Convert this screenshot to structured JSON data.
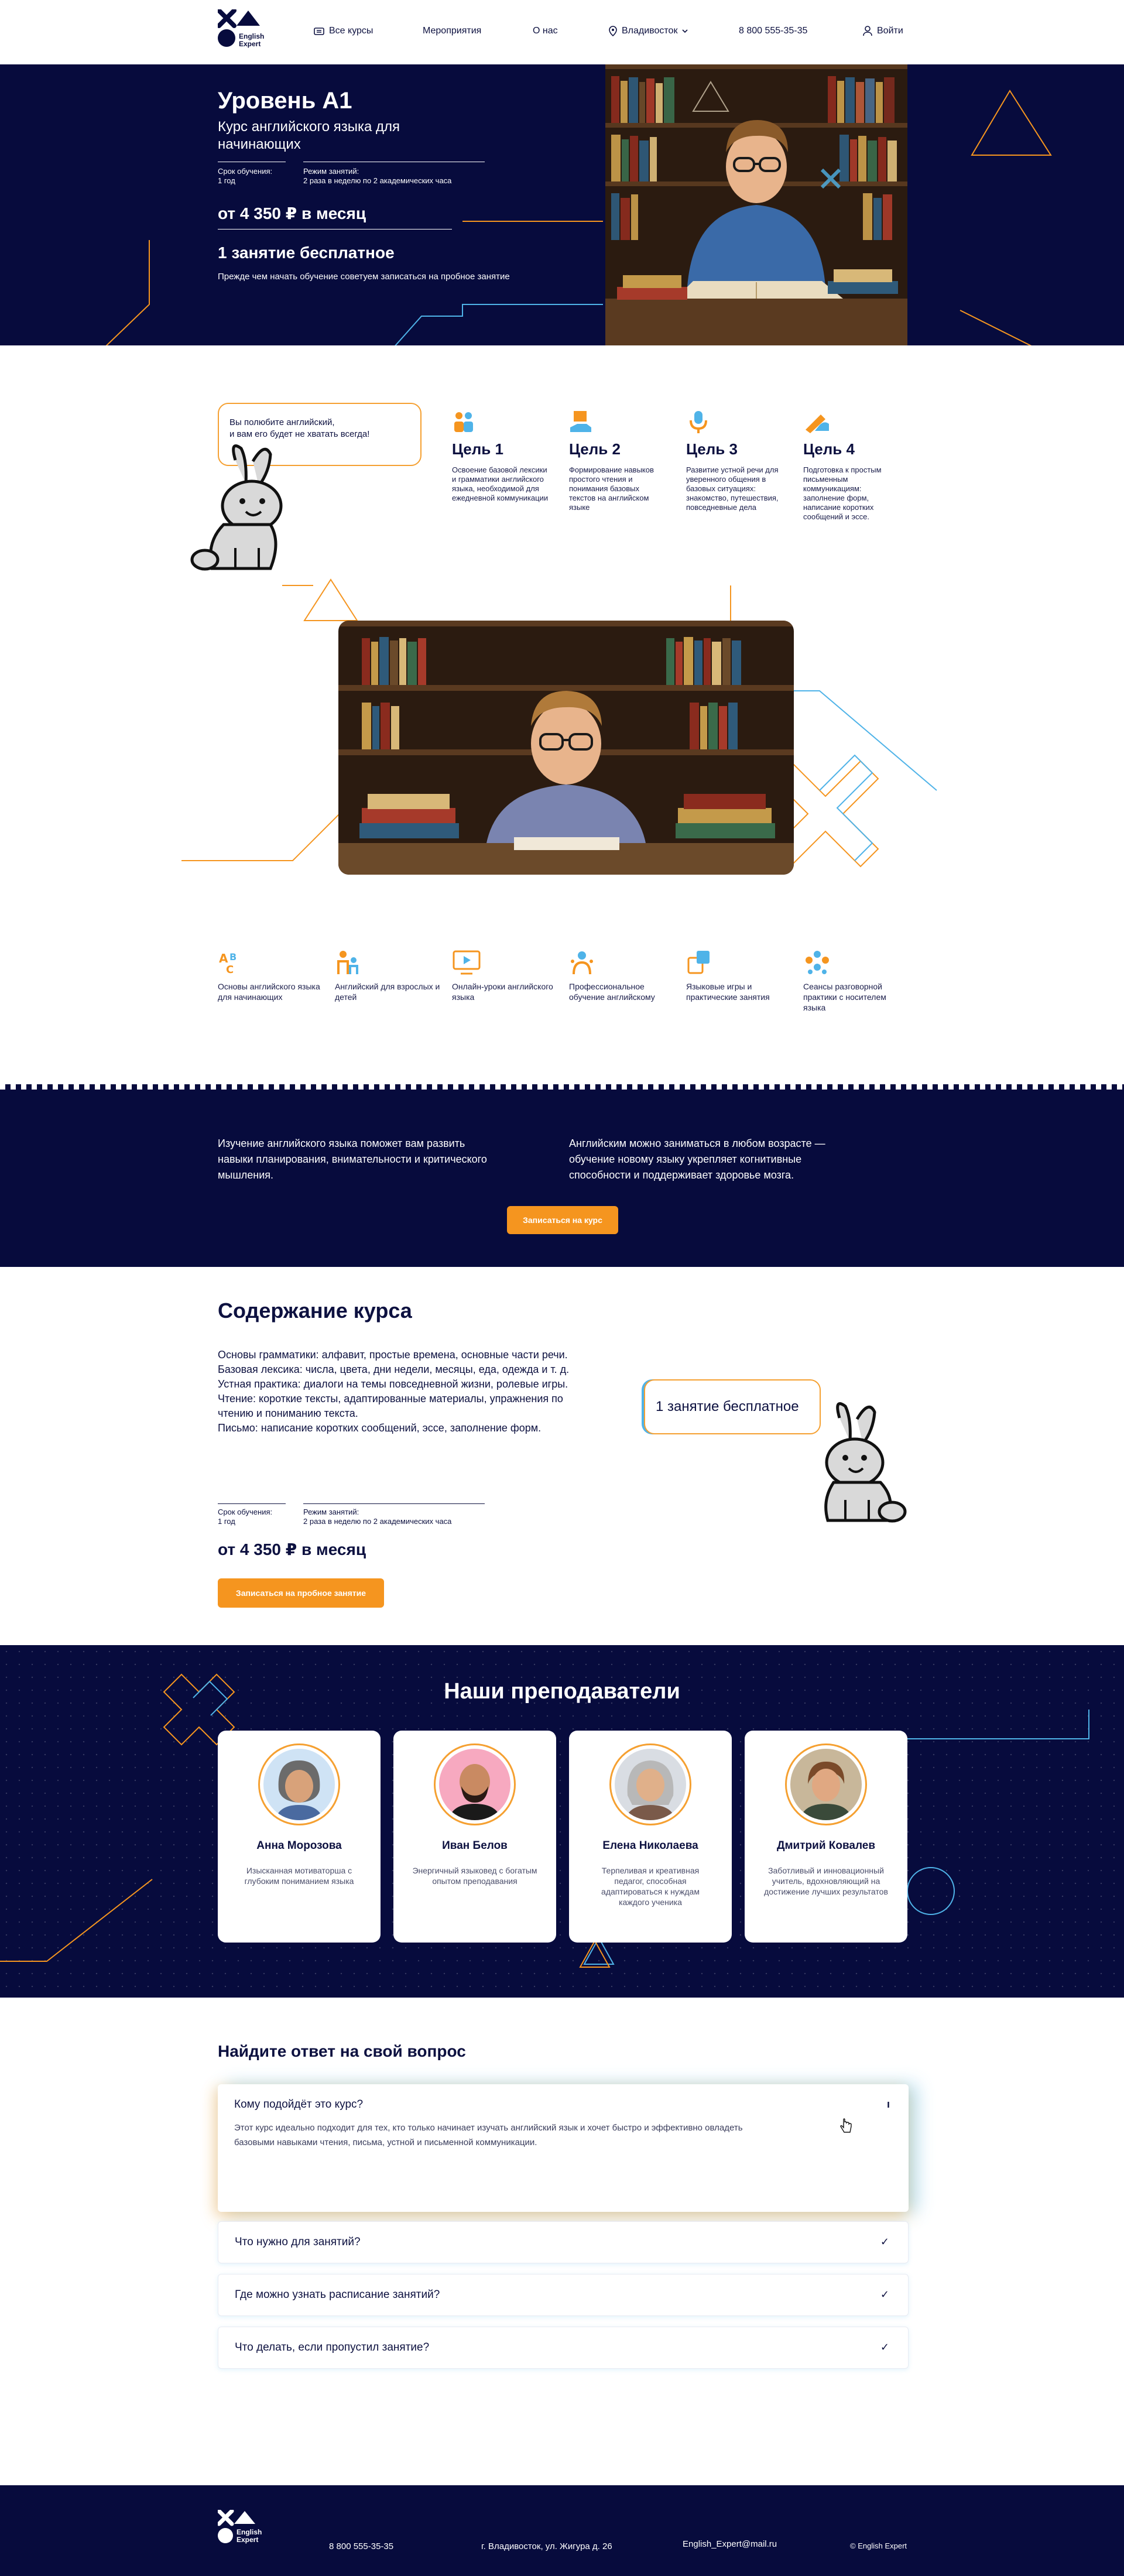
{
  "brand": {
    "name_line1": "English",
    "name_line2": "Expert"
  },
  "nav": {
    "courses": "Все курсы",
    "events": "Мероприятия",
    "about": "О нас",
    "city": "Владивосток",
    "phone": "8 800 555-35-35",
    "login": "Войти"
  },
  "hero": {
    "title": "Уровень А1",
    "subtitle": "Курс английского языка для начинающих",
    "duration_label": "Срок обучения:",
    "duration_value": "1 год",
    "schedule_label": "Режим занятий:",
    "schedule_value": "2 раза в неделю по 2 академических часа",
    "price": "от  4 350 ₽ в месяц",
    "free_lesson": "1 занятие бесплатное",
    "advice": "Прежде чем начать обучение советуем записаться на пробное занятие"
  },
  "bubble_goals": {
    "line1": "Вы полюбите английский,",
    "line2": "и вам его будет не хватать всегда!"
  },
  "goals": [
    {
      "title": "Цель 1",
      "text": "Освоение базовой лексики и грамматики английского языка, необходимой для ежедневной коммуникации"
    },
    {
      "title": "Цель 2",
      "text": "Формирование навыков простого чтения и понимания базовых текстов на английском языке"
    },
    {
      "title": "Цель 3",
      "text": "Развитие устной речи для уверенного общения в базовых ситуациях: знакомство, путешествия, повседневные дела"
    },
    {
      "title": "Цель 4",
      "text": "Подготовка к простым письменным коммуникациям: заполнение форм, написание коротких сообщений и эссе."
    }
  ],
  "features": [
    {
      "text": "Основы английского языка для начинающих"
    },
    {
      "text": "Английский для взрослых и детей"
    },
    {
      "text": "Онлайн-уроки английского языка"
    },
    {
      "text": "Профессиональное обучение английскому"
    },
    {
      "text": "Языковые игры и практические занятия"
    },
    {
      "text": "Сеансы разговорной практики с носителем языка"
    }
  ],
  "banner": {
    "left": "Изучение английского языка поможет вам развить навыки планирования, внимательности и критического мышления.",
    "right": "Английским можно заниматься в любом возрасте — обучение новому языку укрепляет когнитивные способности и поддерживает здоровье мозга.",
    "button": "Записаться на курс"
  },
  "course": {
    "title": "Содержание курса",
    "lines": [
      "Основы грамматики: алфавит, простые времена, основные части речи.",
      "Базовая лексика: числа, цвета, дни недели, месяцы, еда, одежда и т. д.",
      "Устная практика: диалоги на темы повседневной жизни, ролевые игры.",
      "Чтение: короткие тексты, адаптированные материалы, упражнения по чтению и пониманию текста.",
      "Письмо: написание коротких сообщений, эссе, заполнение форм."
    ],
    "duration_label": "Срок обучения:",
    "duration_value": "1 год",
    "schedule_label": "Режим занятий:",
    "schedule_value": "2 раза в неделю по 2 академических часа",
    "price": "от  4 350 ₽ в месяц",
    "button": "Записаться на пробное занятие",
    "bubble": "1 занятие бесплатное"
  },
  "teachers": {
    "title": "Наши преподаватели",
    "items": [
      {
        "name": "Анна Морозова",
        "text": "Изысканная мотиваторша с глубоким пониманием языка",
        "bg": "#cfe3f5"
      },
      {
        "name": "Иван Белов",
        "text": "Энергичный языковед с богатым опытом преподавания",
        "bg": "#f7a9c0"
      },
      {
        "name": "Елена Николаева",
        "text": "Терпеливая и креативная педагог, способная адаптироваться к нуждам каждого ученика",
        "bg": "#d9dde3"
      },
      {
        "name": "Дмитрий Ковалев",
        "text": "Заботливый и инновационный учитель, вдохновляющий на достижение лучших результатов",
        "bg": "#c8b79a"
      }
    ]
  },
  "faq": {
    "title": "Найдите ответ на свой вопрос",
    "items": [
      {
        "q": "Кому подойдёт это курс?",
        "a": "Этот курс идеально подходит для тех, кто только начинает изучать английский язык и хочет быстро и эффективно овладеть базовыми навыками чтения, письма, устной и письменной коммуникации.",
        "toggle": "ı"
      },
      {
        "q": "Что нужно для занятий?",
        "toggle": "✓"
      },
      {
        "q": "Где можно узнать расписание занятий?",
        "toggle": "✓"
      },
      {
        "q": "Что делать, если пропустил занятие?",
        "toggle": "✓"
      }
    ]
  },
  "footer": {
    "phone": "8 800 555-35-35",
    "address": "г. Владивосток, ул. Жигура д. 26",
    "email": "English_Expert@mail.ru",
    "copyright": "© English Expert"
  },
  "colors": {
    "navy": "#070b3d",
    "orange": "#f5951f",
    "blue": "#4fb3e8"
  },
  "icons": [
    "building-icon",
    "location-pin-icon",
    "chevron-down-icon",
    "user-icon",
    "rabbit-illustration",
    "abc-icon",
    "family-icon",
    "monitor-icon",
    "teacher-icon",
    "puzzle-icon",
    "group-icon"
  ]
}
